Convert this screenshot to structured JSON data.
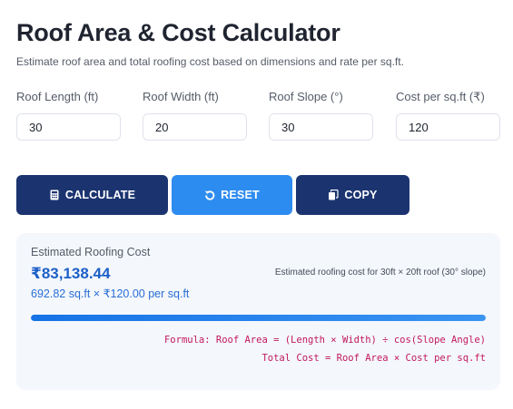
{
  "header": {
    "title": "Roof Area & Cost Calculator",
    "subtitle": "Estimate roof area and total roofing cost based on dimensions and rate per sq.ft."
  },
  "inputs": {
    "length": {
      "label": "Roof Length (ft)",
      "value": "30"
    },
    "width": {
      "label": "Roof Width (ft)",
      "value": "20"
    },
    "slope": {
      "label": "Roof Slope (°)",
      "value": "30"
    },
    "cost": {
      "label": "Cost per sq.ft (₹)",
      "value": "120"
    }
  },
  "buttons": {
    "calculate": {
      "label": "CALCULATE",
      "icon": "calculator-icon"
    },
    "reset": {
      "label": "RESET",
      "icon": "reset-icon"
    },
    "copy": {
      "label": "COPY",
      "icon": "copy-icon"
    }
  },
  "result": {
    "label": "Estimated Roofing Cost",
    "total": "₹83,138.44",
    "detail": "692.82 sq.ft × ₹120.00 per sq.ft",
    "note": "Estimated roofing cost for 30ft × 20ft roof (30° slope)",
    "progress_percent": 100,
    "formula_line1": "Formula: Roof Area = (Length × Width) ÷ cos(Slope Angle)",
    "formula_line2": "Total Cost = Roof Area × Cost per sq.ft"
  },
  "colors": {
    "primary": "#1b3470",
    "accent": "#2d8cf0",
    "total_text": "#1d5fc8",
    "formula_text": "#c2185b",
    "card_bg": "#f4f7fc"
  }
}
